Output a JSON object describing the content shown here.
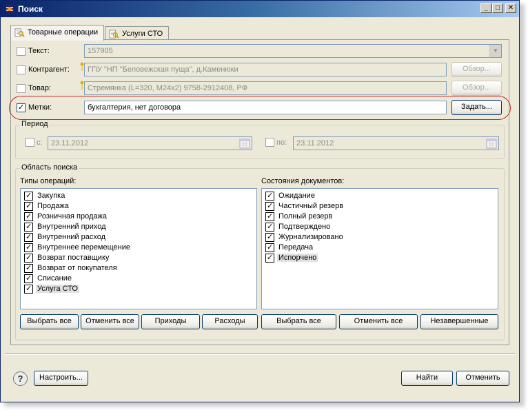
{
  "window": {
    "title": "Поиск",
    "controls": {
      "minimize": "_",
      "maximize": "□",
      "close": "✕"
    }
  },
  "tabs": [
    {
      "label": "Товарные операции",
      "active": true
    },
    {
      "label": "Услуги СТО",
      "active": false
    }
  ],
  "filters": {
    "text": {
      "label": "Текст:",
      "value": "157905",
      "checked": false
    },
    "contractor": {
      "label": "Контрагент:",
      "value": "ГПУ \"НП \"Беловежская пуща\", д.Каменюки",
      "browse": "Обзор...",
      "checked": false
    },
    "product": {
      "label": "Товар:",
      "value": "Стремянка (L=320, М24x2) 9758-2912408, РФ",
      "browse": "Обзор...",
      "checked": false
    },
    "tags": {
      "label": "Метки:",
      "value": "бухгалтерия, нет договора",
      "set": "Задать...",
      "checked": true
    }
  },
  "period": {
    "title": "Период",
    "from_label": "с:",
    "from_value": "23.11.2012",
    "to_label": "по:",
    "to_value": "23.11.2012"
  },
  "search_area": {
    "title": "Область поиска",
    "operations": {
      "label": "Типы операций:",
      "items": [
        {
          "label": "Закупка",
          "checked": true
        },
        {
          "label": "Продажа",
          "checked": true
        },
        {
          "label": "Розничная продажа",
          "checked": true
        },
        {
          "label": "Внутренний приход",
          "checked": true
        },
        {
          "label": "Внутренний расход",
          "checked": true
        },
        {
          "label": "Внутреннее перемещение",
          "checked": true
        },
        {
          "label": "Возврат поставщику",
          "checked": true
        },
        {
          "label": "Возврат от покупателя",
          "checked": true
        },
        {
          "label": "Списание",
          "checked": true
        },
        {
          "label": "Услуга СТО",
          "checked": true
        }
      ],
      "buttons": [
        "Выбрать все",
        "Отменить все",
        "Приходы",
        "Расходы"
      ]
    },
    "states": {
      "label": "Состояния документов:",
      "items": [
        {
          "label": "Ожидание",
          "checked": true
        },
        {
          "label": "Частичный резерв",
          "checked": true
        },
        {
          "label": "Полный резерв",
          "checked": true
        },
        {
          "label": "Подтверждено",
          "checked": true
        },
        {
          "label": "Журнализировано",
          "checked": true
        },
        {
          "label": "Передача",
          "checked": true
        },
        {
          "label": "Испорчено",
          "checked": true
        }
      ],
      "buttons": [
        "Выбрать все",
        "Отменить все",
        "Незавершенные"
      ]
    }
  },
  "footer": {
    "help": "?",
    "configure": "Настроить...",
    "find": "Найти",
    "cancel": "Отменить"
  },
  "colors": {
    "titlebar_start": "#0a246a",
    "highlight": "#cc2222",
    "face": "#ece9d8"
  }
}
